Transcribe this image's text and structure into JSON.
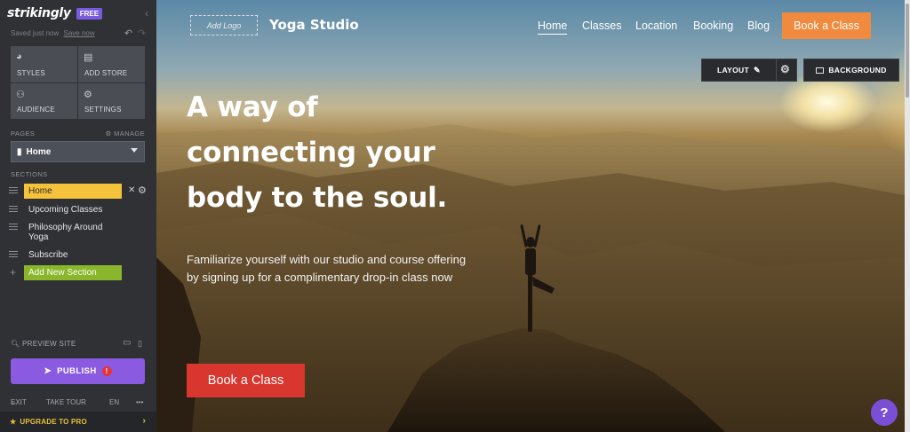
{
  "sidebar": {
    "logo": "strikingly",
    "badge": "FREE",
    "saved_text": "Saved just now",
    "save_now": "Save now",
    "tiles": [
      {
        "icon": "palette-icon",
        "label": "STYLES"
      },
      {
        "icon": "store-icon",
        "label": "ADD STORE"
      },
      {
        "icon": "people-icon",
        "label": "AUDIENCE"
      },
      {
        "icon": "gear-icon",
        "label": "SETTINGS"
      }
    ],
    "pages_label": "PAGES",
    "manage_label": "MANAGE",
    "current_page": "Home",
    "sections_label": "SECTIONS",
    "sections": [
      "Home",
      "Upcoming Classes",
      "Philosophy Around Yoga",
      "Subscribe"
    ],
    "add_section": "Add New Section",
    "preview_label": "PREVIEW SITE",
    "publish_label": "PUBLISH",
    "bottom": {
      "exit": "EXIT",
      "tour": "TAKE TOUR",
      "lang": "EN",
      "more": "•••"
    },
    "upgrade": "UPGRADE TO PRO"
  },
  "site": {
    "logo_placeholder": "Add Logo",
    "brand": "Yoga Studio",
    "nav": [
      "Home",
      "Classes",
      "Location",
      "Booking",
      "Blog"
    ],
    "nav_cta": "Book a Class",
    "layout_btn": "LAYOUT",
    "background_btn": "BACKGROUND",
    "headline": "A way of connecting your body to the soul.",
    "subtext": "Familiarize yourself with our studio and course offering by signing up for a complimentary drop-in class now",
    "cta": "Book a Class",
    "help": "?"
  },
  "colors": {
    "sidebar_bg": "#2f3135",
    "active_section": "#f5c23b",
    "add_section": "#89b62a",
    "publish": "#8a5be0",
    "nav_cta": "#f08a3e",
    "hero_cta": "#d8362f",
    "upgrade_text": "#e8c03a"
  }
}
